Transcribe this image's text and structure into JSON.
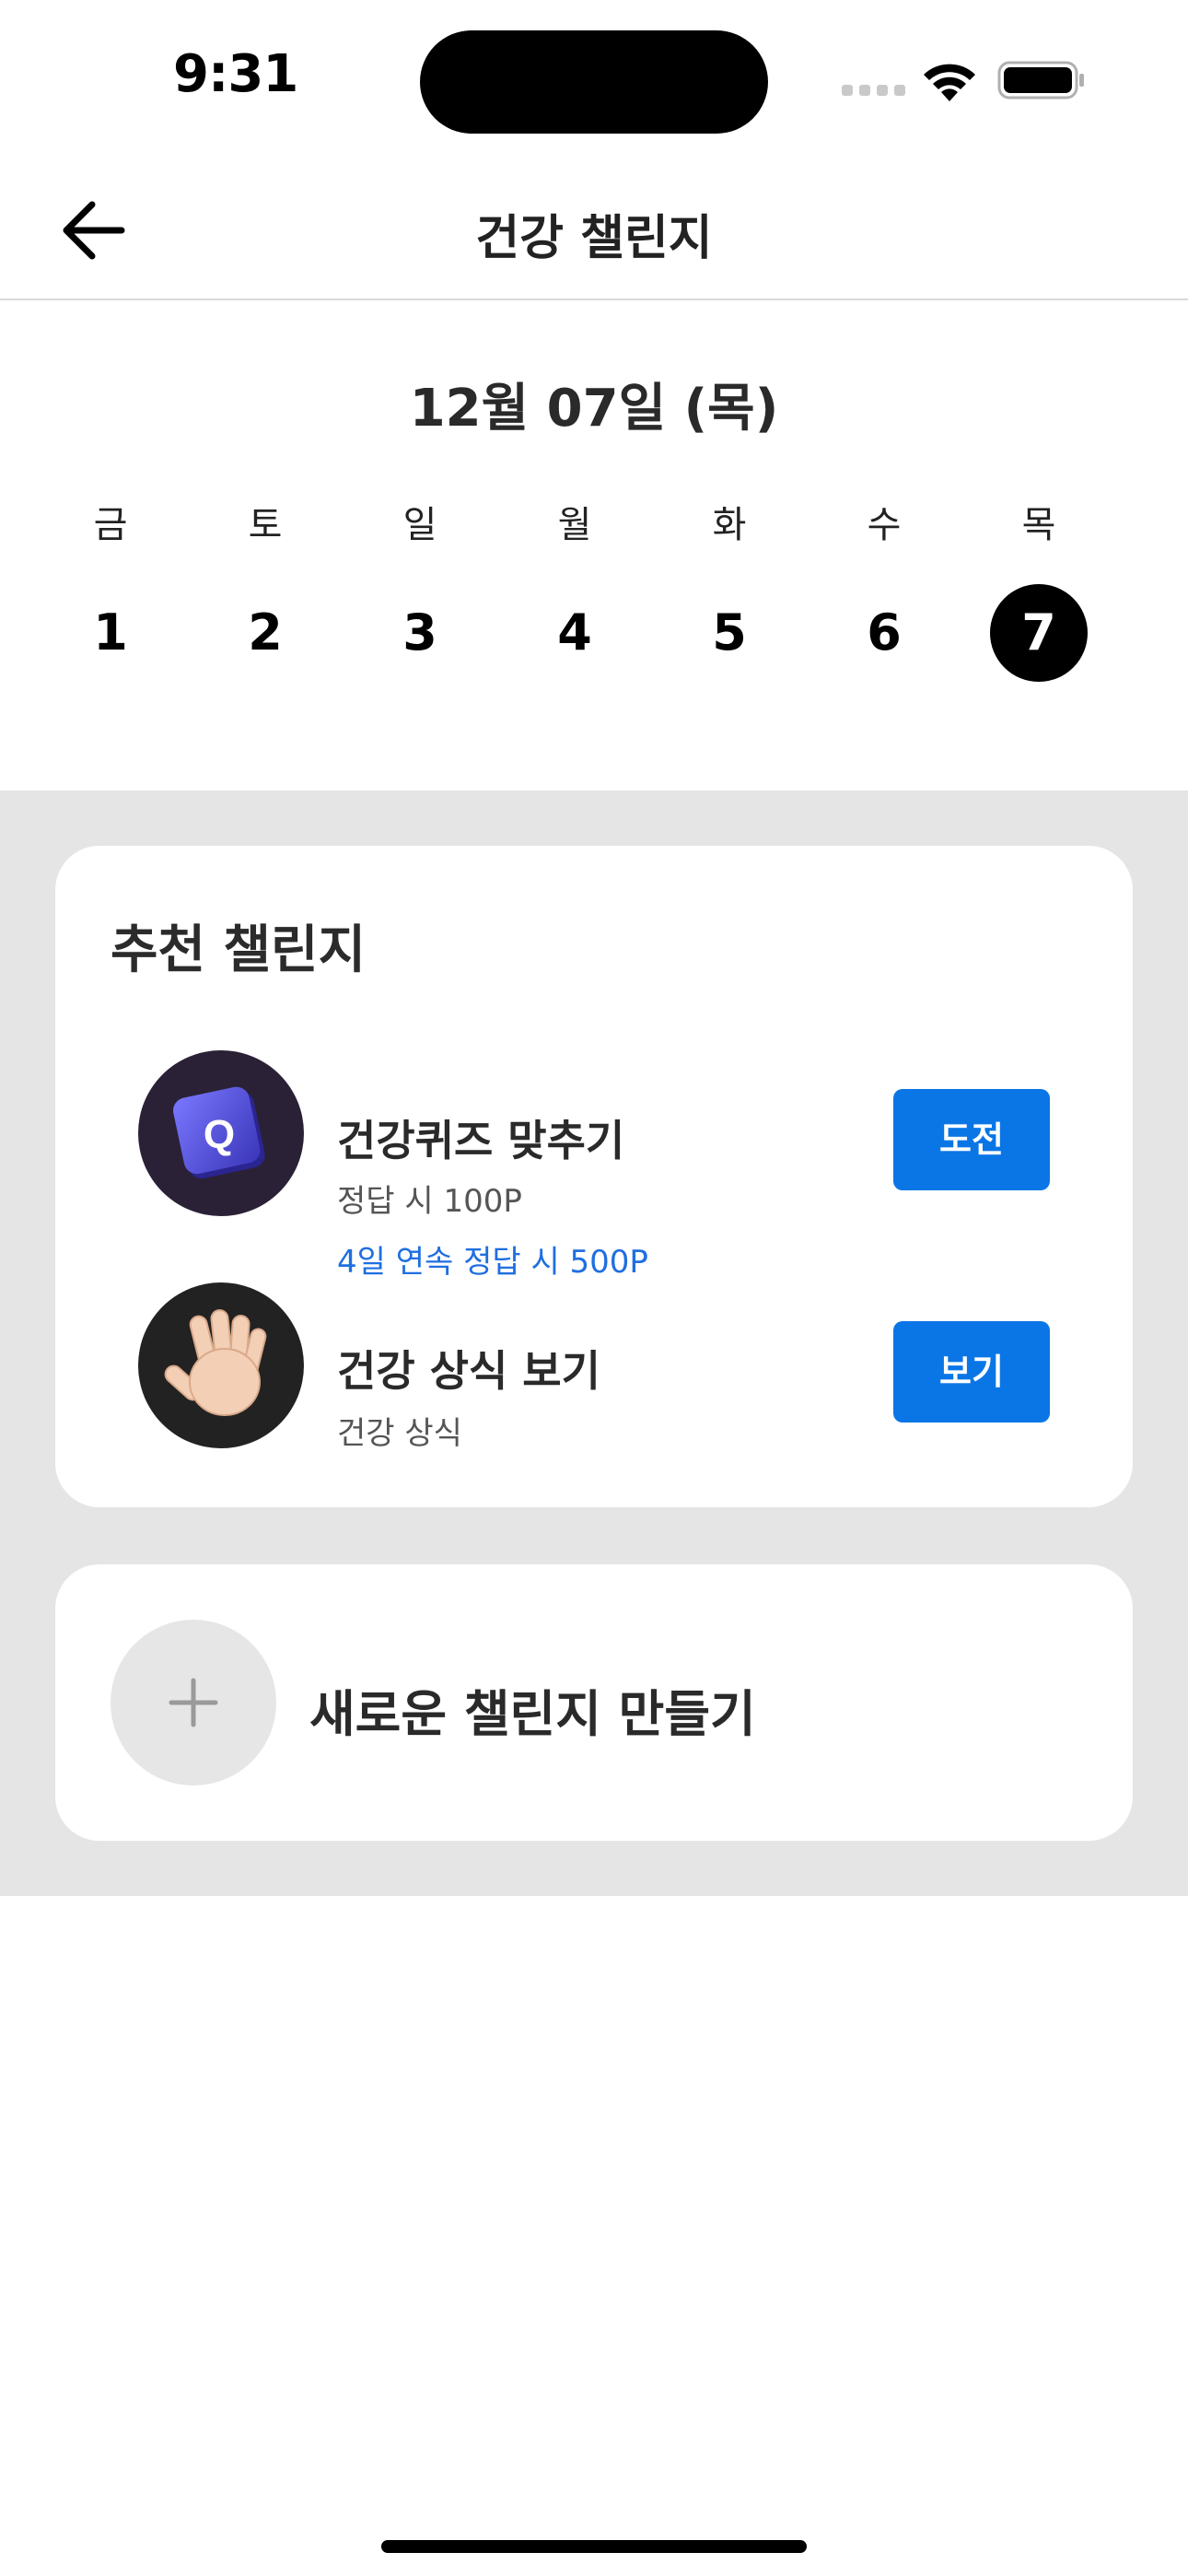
{
  "status_bar": {
    "time": "9:31",
    "signal_icon": "cellular-signal-icon",
    "wifi_icon": "wifi-icon",
    "battery_icon": "battery-full-icon"
  },
  "nav": {
    "back_icon": "arrow-left-icon",
    "title": "건강 챌린지"
  },
  "date": {
    "header": "12월 07일 (목)",
    "days": [
      {
        "weekday": "금",
        "number": "1",
        "selected": false
      },
      {
        "weekday": "토",
        "number": "2",
        "selected": false
      },
      {
        "weekday": "일",
        "number": "3",
        "selected": false
      },
      {
        "weekday": "월",
        "number": "4",
        "selected": false
      },
      {
        "weekday": "화",
        "number": "5",
        "selected": false
      },
      {
        "weekday": "수",
        "number": "6",
        "selected": false
      },
      {
        "weekday": "목",
        "number": "7",
        "selected": true
      }
    ]
  },
  "recommend": {
    "title": "추천 챌린지",
    "items": [
      {
        "icon": "quiz-q-cube-icon",
        "name": "건강퀴즈 맞추기",
        "desc": "정답 시 100P",
        "bonus": "4일 연속 정답 시 500P",
        "button": "도전"
      },
      {
        "icon": "waving-hand-icon",
        "name": "건강 상식 보기",
        "desc": "건강 상식",
        "button": "보기"
      }
    ]
  },
  "create": {
    "icon": "plus-icon",
    "label": "새로운 챌린지 만들기"
  },
  "colors": {
    "accent": "#0a76e6",
    "bonus_text": "#1f6fe0",
    "background_grey": "#e5e5e5",
    "selected_day": "#000000"
  }
}
